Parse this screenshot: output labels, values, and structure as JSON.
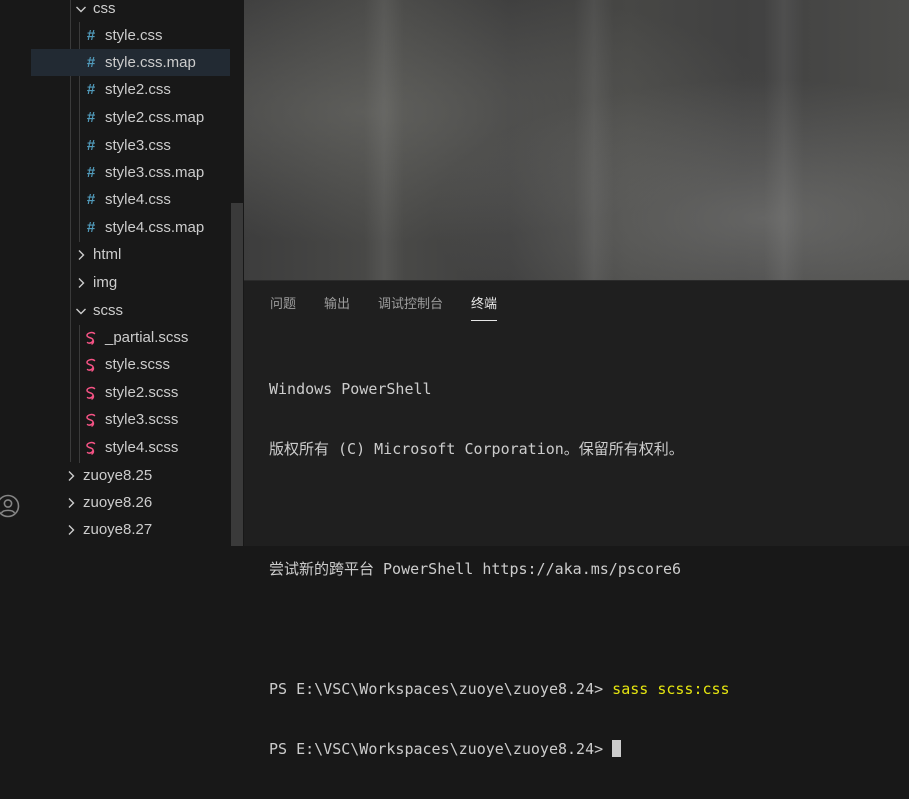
{
  "explorer": {
    "items": [
      {
        "label": "css",
        "kind": "folder",
        "expanded": true
      },
      {
        "label": "style.css",
        "kind": "css"
      },
      {
        "label": "style.css.map",
        "kind": "css",
        "selected": true
      },
      {
        "label": "style2.css",
        "kind": "css"
      },
      {
        "label": "style2.css.map",
        "kind": "css"
      },
      {
        "label": "style3.css",
        "kind": "css"
      },
      {
        "label": "style3.css.map",
        "kind": "css"
      },
      {
        "label": "style4.css",
        "kind": "css"
      },
      {
        "label": "style4.css.map",
        "kind": "css"
      },
      {
        "label": "html",
        "kind": "folder",
        "expanded": false
      },
      {
        "label": "img",
        "kind": "folder",
        "expanded": false
      },
      {
        "label": "scss",
        "kind": "folder",
        "expanded": true
      },
      {
        "label": "_partial.scss",
        "kind": "scss"
      },
      {
        "label": "style.scss",
        "kind": "scss"
      },
      {
        "label": "style2.scss",
        "kind": "scss"
      },
      {
        "label": "style3.scss",
        "kind": "scss"
      },
      {
        "label": "style4.scss",
        "kind": "scss"
      },
      {
        "label": "zuoye8.25",
        "kind": "folder",
        "expanded": false
      },
      {
        "label": "zuoye8.26",
        "kind": "folder",
        "expanded": false
      },
      {
        "label": "zuoye8.27",
        "kind": "folder",
        "expanded": false
      }
    ],
    "css_icon_glyph": "#",
    "colors": {
      "css_icon": "#519aba",
      "scss_icon": "#f55385",
      "selected_bg": "#222a33"
    }
  },
  "panel": {
    "tabs": [
      "问题",
      "输出",
      "调试控制台",
      "终端"
    ],
    "active_tab": "终端"
  },
  "terminal": {
    "line1": "Windows PowerShell",
    "line2": "版权所有 (C) Microsoft Corporation。保留所有权利。",
    "line3": "",
    "line4": "尝试新的跨平台 PowerShell https://aka.ms/pscore6",
    "line5": "",
    "prompt1": "PS E:\\VSC\\Workspaces\\zuoye\\zuoye8.24> ",
    "command1": "sass scss:css",
    "prompt2": "PS E:\\VSC\\Workspaces\\zuoye\\zuoye8.24> ",
    "colors": {
      "command": "#e5e510",
      "text": "#cccccc"
    }
  },
  "icons": {
    "account": "account-icon",
    "chevron_down": "chevron-down-icon",
    "chevron_right": "chevron-right-icon"
  }
}
